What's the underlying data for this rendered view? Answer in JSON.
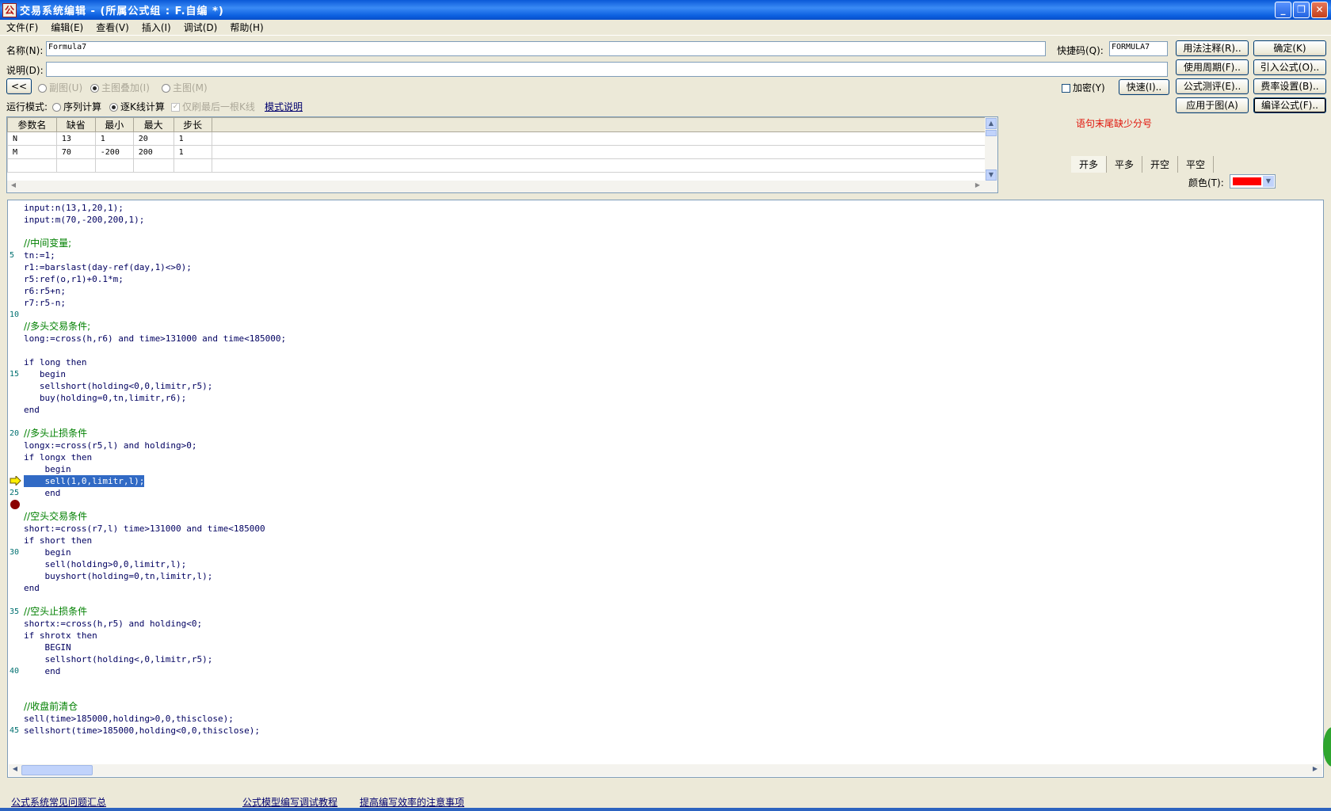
{
  "window": {
    "title": "交易系统编辑 - (所属公式组 : F.自编 *)",
    "app_icon": "app-icon",
    "minimize": "_",
    "maximize": "❐",
    "close": "✕"
  },
  "menu": [
    "文件(F)",
    "编辑(E)",
    "查看(V)",
    "插入(I)",
    "调试(D)",
    "帮助(H)"
  ],
  "form": {
    "name_label": "名称(N):",
    "name_value": "Formula7",
    "shortcut_label": "快捷码(Q):",
    "shortcut_value": "FORMULA7",
    "desc_label": "说明(D):",
    "desc_value": "",
    "collapse_button": "<<",
    "radio_subchart": "副图(U)",
    "radio_overlay": "主图叠加(I)",
    "radio_main": "主图(M)",
    "encrypt_label": "加密(Y)",
    "quick_button": "快速(I)..",
    "run_mode_label": "运行模式:",
    "mode_sequence": "序列计算",
    "mode_kline": "逐K线计算",
    "refresh_last": "仅刷最后一根K线",
    "mode_help": "模式说明"
  },
  "buttons": {
    "usage_notes": "用法注释(R)..",
    "confirm": "确定(K)",
    "use_period": "使用周期(F)..",
    "import_formula": "引入公式(O)..",
    "formula_test": "公式测评(E)..",
    "fee_settings": "费率设置(B)..",
    "apply_to_chart": "应用于图(A)",
    "compile": "编译公式(F).."
  },
  "params": {
    "headers": [
      "参数名",
      "缺省",
      "最小",
      "最大",
      "步长"
    ],
    "rows": [
      [
        "N",
        "13",
        "1",
        "20",
        "1"
      ],
      [
        "M",
        "70",
        "-200",
        "200",
        "1"
      ],
      [
        "",
        "",
        "",
        "",
        ""
      ]
    ]
  },
  "error_message": "语句末尾缺少分号",
  "signal_tabs": [
    "开多",
    "平多",
    "开空",
    "平空"
  ],
  "color_label": "颜色(T):",
  "signal_color": "#ff0000",
  "code_lines": [
    {
      "t": "input:n(13,1,20,1);",
      "c": false
    },
    {
      "t": "input:m(70,-200,200,1);",
      "c": false
    },
    {
      "t": "",
      "c": false
    },
    {
      "t": "//中间变量;",
      "c": true
    },
    {
      "t": "tn:=1;",
      "c": false
    },
    {
      "t": "r1:=barslast(day-ref(day,1)<>0);",
      "c": false
    },
    {
      "t": "r5:ref(o,r1)+0.1*m;",
      "c": false
    },
    {
      "t": "r6:r5+n;",
      "c": false
    },
    {
      "t": "r7:r5-n;",
      "c": false
    },
    {
      "t": "",
      "c": false
    },
    {
      "t": "//多头交易条件;",
      "c": true
    },
    {
      "t": "long:=cross(h,r6) and time>131000 and time<185000;",
      "c": false
    },
    {
      "t": "",
      "c": false
    },
    {
      "t": "if long then",
      "c": false
    },
    {
      "t": "   begin",
      "c": false
    },
    {
      "t": "   sellshort(holding<0,0,limitr,r5);",
      "c": false
    },
    {
      "t": "   buy(holding=0,tn,limitr,r6);",
      "c": false
    },
    {
      "t": "end",
      "c": false
    },
    {
      "t": "",
      "c": false
    },
    {
      "t": "//多头止损条件",
      "c": true
    },
    {
      "t": "longx:=cross(r5,l) and holding>0;",
      "c": false
    },
    {
      "t": "if longx then",
      "c": false
    },
    {
      "t": "    begin",
      "c": false
    },
    {
      "t": "    sell(1,0,limitr,l);",
      "c": false,
      "sel": true
    },
    {
      "t": "    end",
      "c": false
    },
    {
      "t": "",
      "c": false
    },
    {
      "t": "//空头交易条件",
      "c": true
    },
    {
      "t": "short:=cross(r7,l) time>131000 and time<185000",
      "c": false
    },
    {
      "t": "if short then",
      "c": false
    },
    {
      "t": "    begin",
      "c": false
    },
    {
      "t": "    sell(holding>0,0,limitr,l);",
      "c": false
    },
    {
      "t": "    buyshort(holding=0,tn,limitr,l);",
      "c": false
    },
    {
      "t": "end",
      "c": false
    },
    {
      "t": "",
      "c": false
    },
    {
      "t": "//空头止损条件",
      "c": true
    },
    {
      "t": "shortx:=cross(h,r5) and holding<0;",
      "c": false
    },
    {
      "t": "if shrotx then",
      "c": false
    },
    {
      "t": "    BEGIN",
      "c": false
    },
    {
      "t": "    sellshort(holding<,0,limitr,r5);",
      "c": false
    },
    {
      "t": "    end",
      "c": false
    },
    {
      "t": "",
      "c": false
    },
    {
      "t": "",
      "c": false
    },
    {
      "t": "//收盘前清仓",
      "c": true
    },
    {
      "t": "sell(time>185000,holding>0,0,thisclose);",
      "c": false
    },
    {
      "t": "sellshort(time>185000,holding<0,0,thisclose);",
      "c": false
    }
  ],
  "line_numbers": [
    "5",
    "10",
    "15",
    "20",
    "25",
    "30",
    "35",
    "40",
    "45"
  ],
  "debug": {
    "current_line": 24,
    "breakpoint_line": 26
  },
  "footer_links": [
    "公式系统常见问题汇总",
    "公式模型编写调试教程",
    "提高编写效率的注意事项"
  ]
}
